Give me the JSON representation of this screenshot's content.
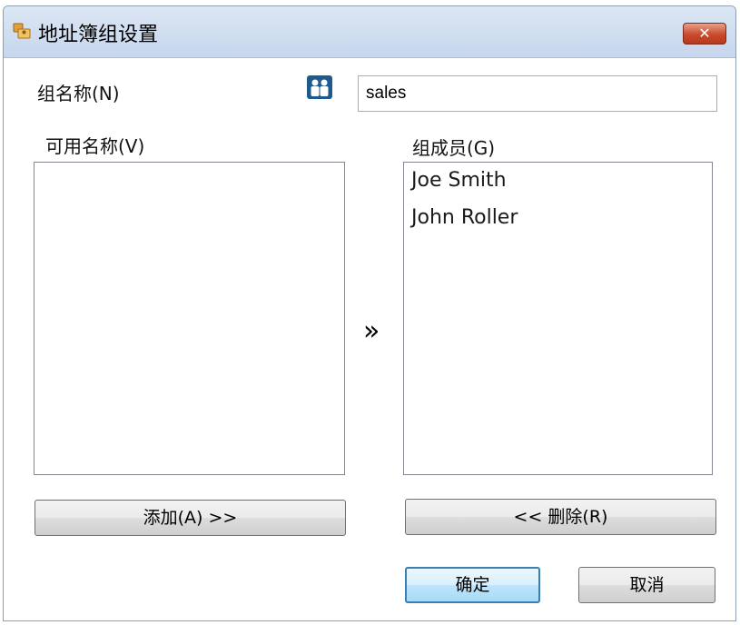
{
  "window": {
    "title": "地址簿组设置",
    "close_label": "✕"
  },
  "group_name": {
    "label": "组名称(N)",
    "value": "sales"
  },
  "available": {
    "label": "可用名称(V)",
    "items": []
  },
  "members": {
    "label": "组成员(G)",
    "items": [
      "Joe Smith",
      "John Roller"
    ]
  },
  "arrow": "»",
  "buttons": {
    "add": "添加(A) >>",
    "remove": "<< 删除(R)",
    "ok": "确定",
    "cancel": "取消"
  },
  "colors": {
    "titlebar": "#c6d6ec",
    "close": "#c94a2c",
    "default_button": "#3c7fb1"
  }
}
